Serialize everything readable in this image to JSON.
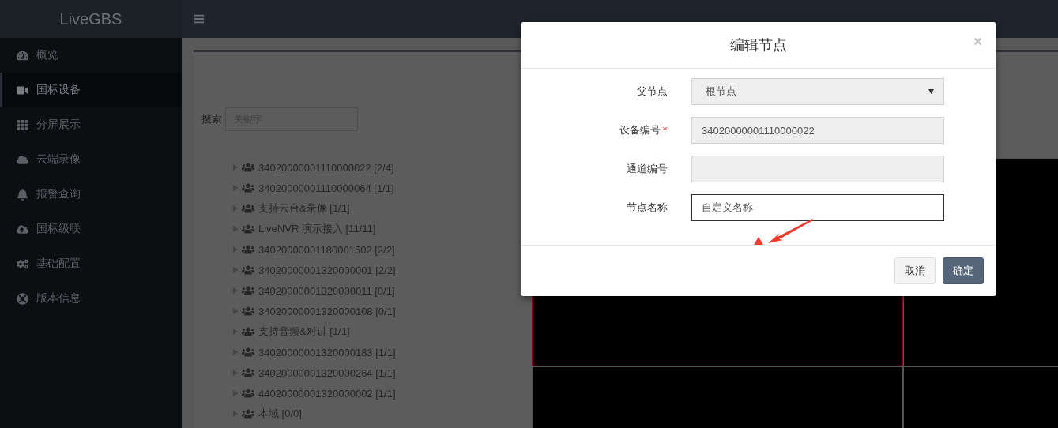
{
  "header": {
    "logo": "LiveGBS"
  },
  "sidebar": {
    "items": [
      {
        "label": "概览",
        "selected": false
      },
      {
        "label": "国标设备",
        "selected": true
      },
      {
        "label": "分屏展示",
        "selected": false
      },
      {
        "label": "云端录像",
        "selected": false
      },
      {
        "label": "报警查询",
        "selected": false
      },
      {
        "label": "国标级联",
        "selected": false
      },
      {
        "label": "基础配置",
        "selected": false
      },
      {
        "label": "版本信息",
        "selected": false
      }
    ]
  },
  "search": {
    "label": "搜索",
    "placeholder": "关键字"
  },
  "tree": [
    {
      "label": "34020000001110000022 [2/4]",
      "expanded": false
    },
    {
      "label": "34020000001110000064 [1/1]",
      "expanded": false
    },
    {
      "label": "支持云台&录像 [1/1]",
      "expanded": false
    },
    {
      "label": "LiveNVR 演示接入 [11/11]",
      "expanded": false
    },
    {
      "label": "34020000001180001502 [2/2]",
      "expanded": false
    },
    {
      "label": "34020000001320000001 [2/2]",
      "expanded": false
    },
    {
      "label": "34020000001320000011 [0/1]",
      "expanded": false
    },
    {
      "label": "34020000001320000108 [0/1]",
      "expanded": false
    },
    {
      "label": "支持音频&对讲 [1/1]",
      "expanded": false
    },
    {
      "label": "34020000001320000183 [1/1]",
      "expanded": false
    },
    {
      "label": "34020000001320000264 [1/1]",
      "expanded": false
    },
    {
      "label": "44020000001320000002 [1/1]",
      "expanded": false
    },
    {
      "label": "本域 [0/0]",
      "expanded": false
    }
  ],
  "video_grid": {
    "cells": [
      {
        "selected": true
      },
      {
        "selected": false
      },
      {
        "selected": false
      },
      {
        "selected": false
      }
    ]
  },
  "dialog": {
    "title": "编辑节点",
    "fields": [
      {
        "kind": "select",
        "label": "父节点",
        "value": "根节点",
        "disabled": true
      },
      {
        "kind": "text",
        "label": "设备编号",
        "required_mark": "*",
        "value": "34020000001110000022",
        "disabled": true
      },
      {
        "kind": "text",
        "label": "通道编号",
        "disabled": true
      },
      {
        "kind": "text",
        "label": "节点名称",
        "value": "自定义名称",
        "disabled": false
      }
    ],
    "buttons": [
      {
        "label": "取消",
        "kind": "default"
      },
      {
        "label": "确定",
        "kind": "primary"
      }
    ]
  }
}
